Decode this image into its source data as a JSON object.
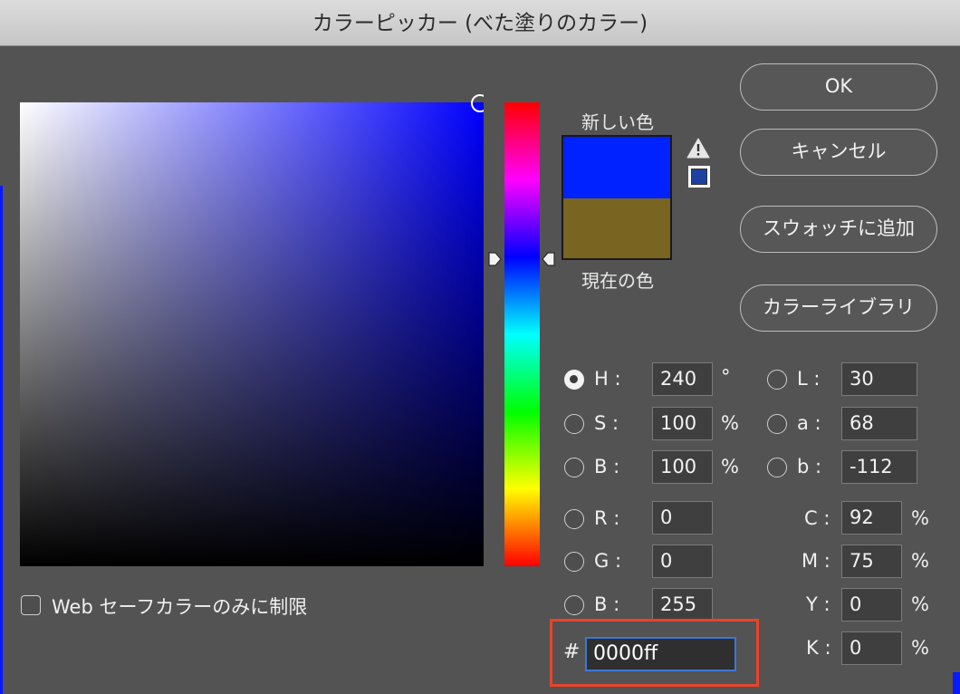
{
  "window": {
    "title": "カラーピッカー (べた塗りのカラー)"
  },
  "preview": {
    "new_label": "新しい色",
    "current_label": "現在の色",
    "new_color": "#0022ff",
    "current_color": "#7a6421"
  },
  "buttons": {
    "ok": "OK",
    "cancel": "キャンセル",
    "add_swatch": "スウォッチに追加",
    "color_libraries": "カラーライブラリ"
  },
  "hsb": [
    {
      "key": "H",
      "label": "H :",
      "value": "240",
      "unit": "°",
      "selected": true
    },
    {
      "key": "S",
      "label": "S :",
      "value": "100",
      "unit": "%",
      "selected": false
    },
    {
      "key": "B",
      "label": "B :",
      "value": "100",
      "unit": "%",
      "selected": false
    }
  ],
  "rgb": [
    {
      "key": "R",
      "label": "R :",
      "value": "0",
      "selected": false
    },
    {
      "key": "G",
      "label": "G :",
      "value": "0",
      "selected": false
    },
    {
      "key": "B",
      "label": "B :",
      "value": "255",
      "selected": false
    }
  ],
  "lab": [
    {
      "key": "L",
      "label": "L :",
      "value": "30",
      "selected": false
    },
    {
      "key": "a",
      "label": "a :",
      "value": "68",
      "selected": false
    },
    {
      "key": "b",
      "label": "b :",
      "value": "-112",
      "selected": false
    }
  ],
  "cmyk": [
    {
      "key": "C",
      "label": "C :",
      "value": "92",
      "unit": "%"
    },
    {
      "key": "M",
      "label": "M :",
      "value": "75",
      "unit": "%"
    },
    {
      "key": "Y",
      "label": "Y :",
      "value": "0",
      "unit": "%"
    },
    {
      "key": "K",
      "label": "K :",
      "value": "0",
      "unit": "%"
    }
  ],
  "hex": {
    "hash": "#",
    "value": "0000ff"
  },
  "websafe": {
    "label": "Web セーフカラーのみに制限",
    "checked": false
  },
  "icons": {
    "gamut_warning": "warning-triangle-icon",
    "websafe_swatch": "websafe-swatch-icon"
  },
  "colors": {
    "dialog_bg": "#535353",
    "hex_highlight": "#e8442a",
    "field_focus": "#3b78d8"
  }
}
